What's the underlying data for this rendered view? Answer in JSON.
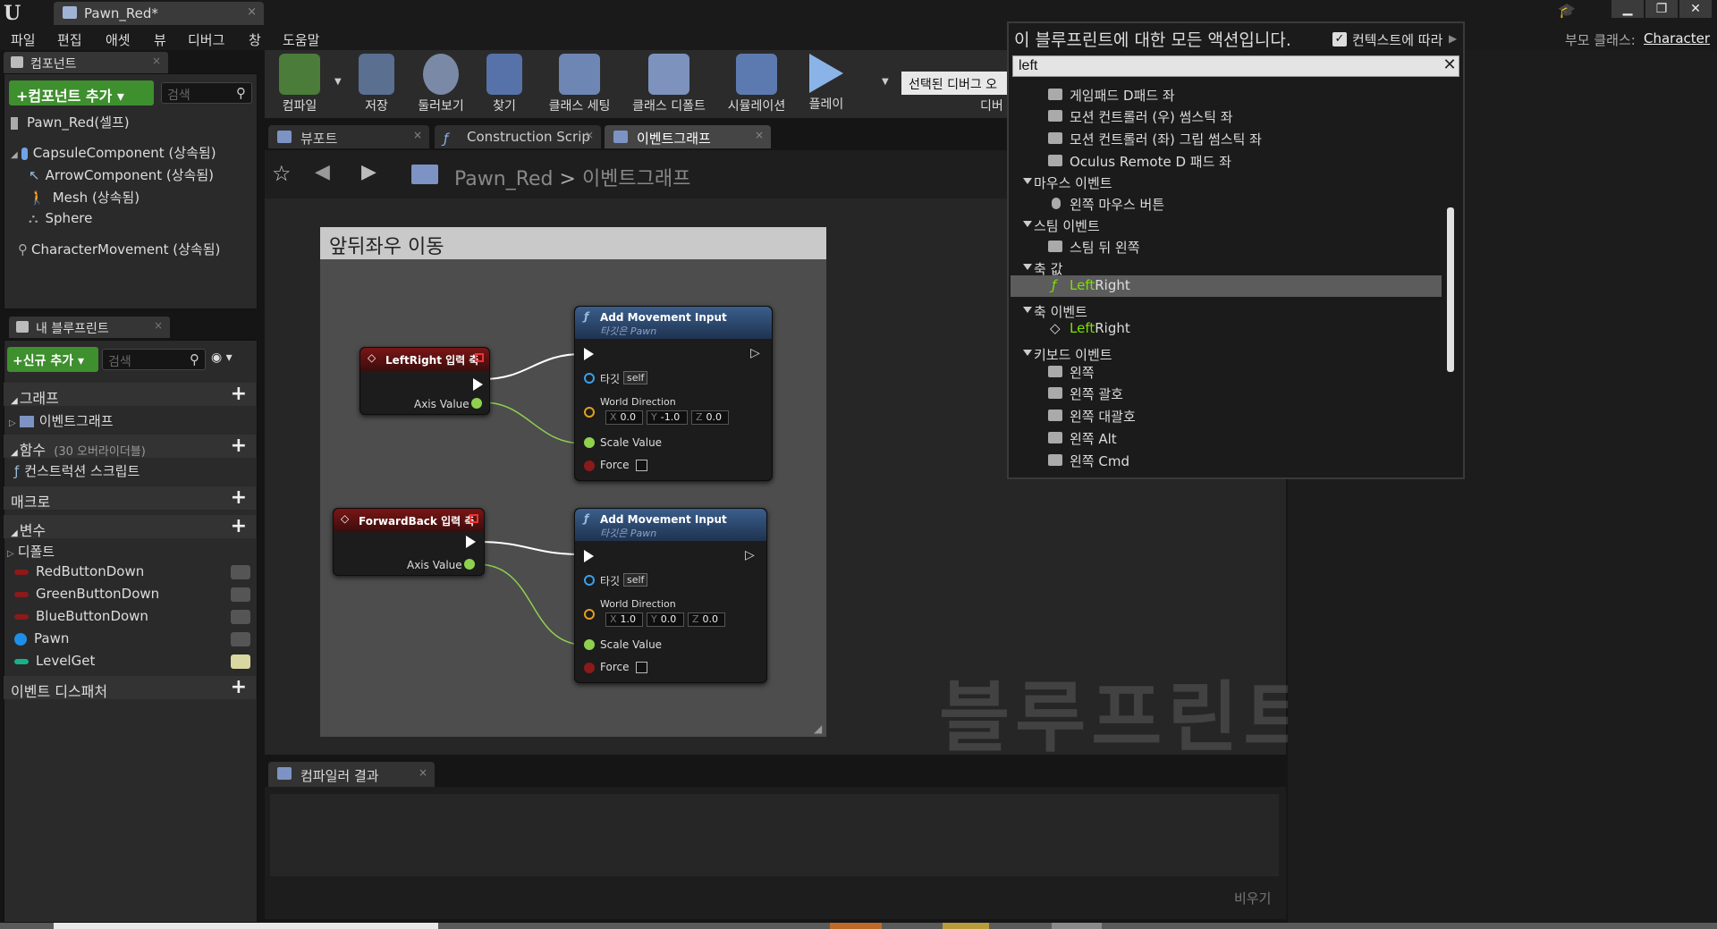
{
  "window": {
    "logo": "U",
    "doc_tab": "Pawn_Red*",
    "min": "▁",
    "max": "❐",
    "close": "✕"
  },
  "menu": [
    "파일",
    "편집",
    "애셋",
    "뷰",
    "디버그",
    "창",
    "도움말"
  ],
  "parent_class": {
    "label": "부모 클래스:",
    "value": "Character"
  },
  "components_panel": {
    "tab": "컴포넌트",
    "add_button": "+컴포넌트 추가 ▾",
    "search_placeholder": "검색",
    "root": "Pawn_Red(셀프)",
    "items": [
      "CapsuleComponent (상속됨)",
      "ArrowComponent (상속됨)",
      "Mesh (상속됨)",
      "Sphere",
      "CharacterMovement (상속됨)"
    ]
  },
  "blueprint_panel": {
    "tab": "내 블루프린트",
    "add_button": "+신규 추가 ▾",
    "search_placeholder": "검색",
    "eye": "◉ ▾",
    "categories": {
      "graph": "그래프",
      "event_graph": "이벤트그래프",
      "functions": "함수",
      "functions_hint": "(30 오버라이더블)",
      "construction": "컨스트럭션 스크립트",
      "macros": "매크로",
      "variables": "변수",
      "default": "디폴트",
      "dispatchers": "이벤트 디스패처"
    },
    "variables": [
      {
        "name": "RedButtonDown",
        "color": "#8b1a1a"
      },
      {
        "name": "GreenButtonDown",
        "color": "#8b1a1a"
      },
      {
        "name": "BlueButtonDown",
        "color": "#8b1a1a"
      },
      {
        "name": "Pawn",
        "color": "#1e8fe8"
      },
      {
        "name": "LevelGet",
        "color": "#18b08a"
      }
    ]
  },
  "toolbar": {
    "compile": "컴파일",
    "save": "저장",
    "browse": "둘러보기",
    "find": "찾기",
    "class_settings": "클래스 세팅",
    "class_defaults": "클래스 디폴트",
    "simulation": "시뮬레이션",
    "play": "플레이",
    "debug_select": "선택된 디버그 오",
    "debug_label": "디버"
  },
  "graph_tabs": [
    "뷰포트",
    "Construction Scrip",
    "이벤트그래프"
  ],
  "breadcrumb": {
    "root": "Pawn_Red",
    "sep": ">",
    "current": "이벤트그래프"
  },
  "comment": "앞뒤좌우 이동",
  "nodes": {
    "event1": {
      "title": "LeftRight 입력 축",
      "axis": "Axis Value"
    },
    "event2": {
      "title": "ForwardBack 입력 축",
      "axis": "Axis Value"
    },
    "func1": {
      "title": "Add Movement Input",
      "subtitle": "타깃은 Pawn",
      "target": "타깃",
      "self": "self",
      "world_direction": "World Direction",
      "x": "0.0",
      "y": "-1.0",
      "z": "0.0",
      "scale": "Scale Value",
      "force": "Force"
    },
    "func2": {
      "title": "Add Movement Input",
      "subtitle": "타깃은 Pawn",
      "target": "타깃",
      "self": "self",
      "world_direction": "World Direction",
      "x": "1.0",
      "y": "0.0",
      "z": "0.0",
      "scale": "Scale Value",
      "force": "Force"
    }
  },
  "axis_labels": {
    "x": "X",
    "y": "Y",
    "z": "Z"
  },
  "watermark": "블루프린트",
  "compiler": {
    "tab": "컴파일러 결과",
    "clear": "비우기"
  },
  "action_menu": {
    "title": "이 블루프린트에 대한 모든 액션입니다.",
    "context": "컨텍스트에 따라",
    "search_value": "left",
    "rows": [
      {
        "type": "item",
        "label": "게임패드 D패드 좌"
      },
      {
        "type": "item",
        "label": "모션 컨트롤러 (우) 썸스틱 좌"
      },
      {
        "type": "item",
        "label": "모션 컨트롤러 (좌) 그립 썸스틱 좌"
      },
      {
        "type": "item",
        "label": "Oculus Remote D 패드 좌"
      },
      {
        "type": "cat",
        "label": "마우스 이벤트"
      },
      {
        "type": "item",
        "label": "왼쪽 마우스 버튼"
      },
      {
        "type": "cat",
        "label": "스팀 이벤트"
      },
      {
        "type": "item",
        "label": "스팀 뒤 왼쪽"
      },
      {
        "type": "cat",
        "label": "축 값"
      },
      {
        "type": "sel",
        "label_hl": "Left",
        "label_rest": "Right"
      },
      {
        "type": "cat",
        "label": "축 이벤트"
      },
      {
        "type": "item2",
        "label_hl": "Left",
        "label_rest": "Right"
      },
      {
        "type": "cat",
        "label": "키보드 이벤트"
      },
      {
        "type": "item",
        "label": "왼쪽"
      },
      {
        "type": "item",
        "label": "왼쪽 괄호"
      },
      {
        "type": "item",
        "label": "왼쪽 대괄호"
      },
      {
        "type": "item",
        "label": "왼쪽 Alt"
      },
      {
        "type": "item",
        "label": "왼쪽 Cmd"
      }
    ]
  }
}
